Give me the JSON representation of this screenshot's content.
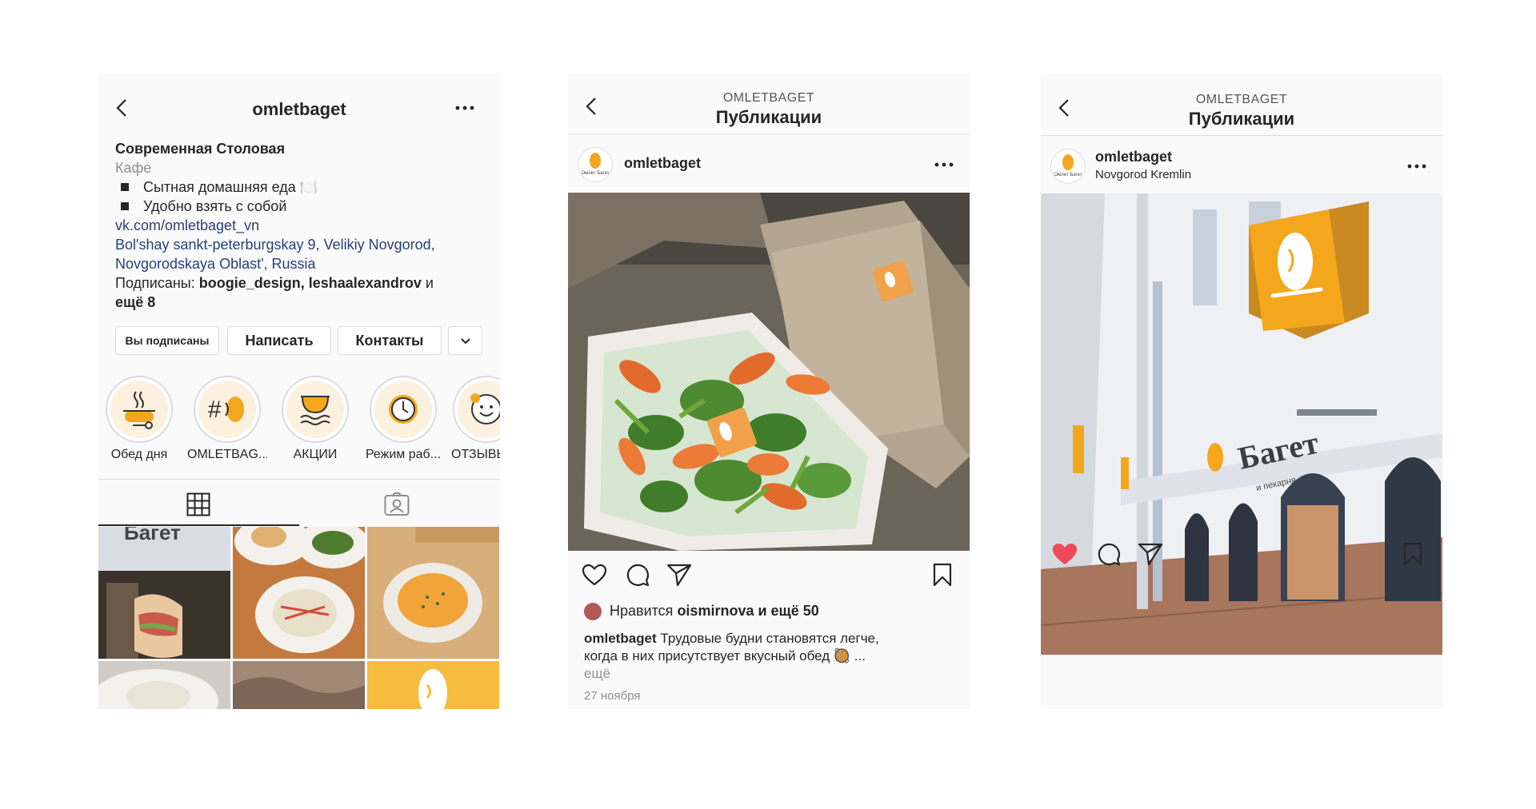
{
  "profile": {
    "username": "omletbaget",
    "bio_name": "Современная Столовая",
    "category": "Кафе",
    "bio_lines": [
      "Сытная домашняя еда 🍽️",
      "Удобно взять с собой"
    ],
    "link": "vk.com/omletbaget_vn",
    "address_1": "Bol'shay sankt-peterburgskay 9, Velikiy Novgorod,",
    "address_2": "Novgorodskaya Oblast', Russia",
    "followed_prefix": "Подписаны: ",
    "followed_names": "boogie_design, leshaalexandrov",
    "followed_and": " и",
    "followed_more": "ещё 8",
    "buttons": {
      "following": "Вы подписаны",
      "message": "Написать",
      "contacts": "Контакты"
    },
    "highlights": [
      "Обед дня",
      "OMLETBAG...",
      "АКЦИИ",
      "Режим раб...",
      "ОТЗЫВЫ"
    ]
  },
  "post1": {
    "nav_sub": "OMLETBAGET",
    "nav_title": "Публикации",
    "username": "omletbaget",
    "likes_prefix": "Нравится ",
    "likes_user": "oismirnova",
    "likes_suffix": " и ещё 50",
    "caption_user": "omletbaget",
    "caption_text_1": " Трудовые будни становятся легче,",
    "caption_text_2": "когда в них присутствует вкусный обед 🥘 ...",
    "more": "ещё",
    "date": "27 ноября"
  },
  "post2": {
    "nav_sub": "OMLETBAGET",
    "nav_title": "Публикации",
    "username": "omletbaget",
    "location": "Novgorod Kremlin",
    "sign_text": "Багет",
    "sign_sub": "и пекарня"
  },
  "colors": {
    "brand_orange": "#f4a71d",
    "link_blue": "#2a3f78",
    "like_red": "#ed4956"
  }
}
